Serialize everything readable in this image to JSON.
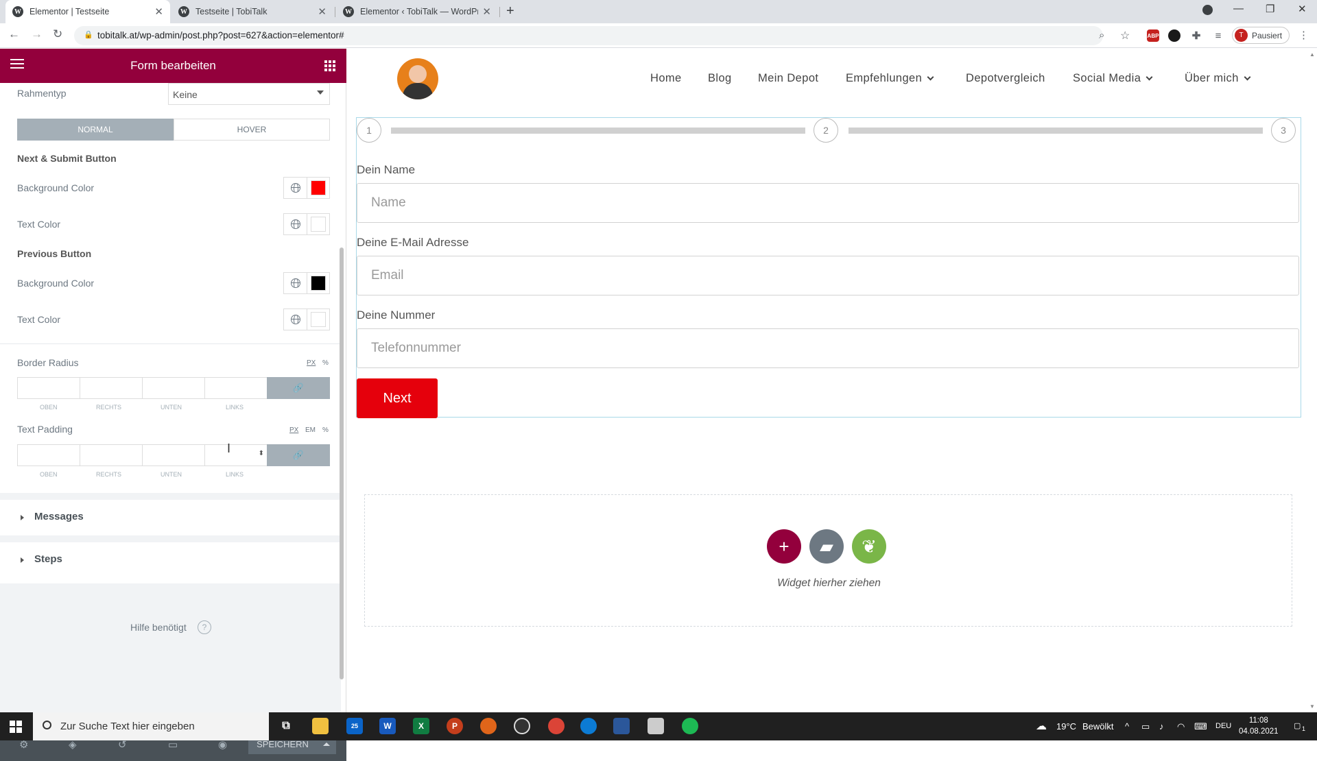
{
  "browser": {
    "tabs": [
      {
        "title": "Elementor | Testseite",
        "icon": "wordpress-icon"
      },
      {
        "title": "Testseite | TobiTalk",
        "icon": "wordpress-icon"
      },
      {
        "title": "Elementor ‹ TobiTalk — WordPress",
        "icon": "wordpress-icon"
      }
    ],
    "url": "tobitalk.at/wp-admin/post.php?post=627&action=elementor#",
    "profile_avatar": "T",
    "profile_status": "Pausiert",
    "ext_abp": "ABP"
  },
  "panel": {
    "title": "Form bearbeiten",
    "border_type_label": "Rahmentyp",
    "border_type_value": "Keine",
    "tab_normal": "NORMAL",
    "tab_hover": "HOVER",
    "next_submit_heading": "Next & Submit Button",
    "background_color_label": "Background Color",
    "text_color_label": "Text Color",
    "previous_heading": "Previous Button",
    "colors": {
      "next_bg": "#ff0000",
      "next_text": "#ffffff",
      "prev_bg": "#000000",
      "prev_text": "#ffffff"
    },
    "border_radius_label": "Border Radius",
    "units_px": "PX",
    "units_percent": "%",
    "units_em": "EM",
    "text_padding_label": "Text Padding",
    "dim_labels": [
      "OBEN",
      "RECHTS",
      "UNTEN",
      "LINKS"
    ],
    "section_messages": "Messages",
    "section_steps": "Steps",
    "help_text": "Hilfe benötigt",
    "help_icon": "?",
    "save_label": "SPEICHERN"
  },
  "site": {
    "nav": [
      "Home",
      "Blog",
      "Mein Depot",
      "Empfehlungen",
      "Depotvergleich",
      "Social Media",
      "Über mich"
    ],
    "steps": [
      "1",
      "2",
      "3"
    ],
    "fields": [
      {
        "label": "Dein Name",
        "placeholder": "Name"
      },
      {
        "label": "Deine E-Mail Adresse",
        "placeholder": "Email"
      },
      {
        "label": "Deine Nummer",
        "placeholder": "Telefonnummer"
      }
    ],
    "next_button": "Next",
    "dropzone_text": "Widget hierher ziehen",
    "accent_color": "#93003c",
    "button_color": "#e5000c"
  },
  "taskbar": {
    "search_placeholder": "Zur Suche Text hier eingeben",
    "mail_badge": "25",
    "weather": "19°C",
    "weather_desc": "Bewölkt",
    "language": "DEU",
    "time": "11:08",
    "date": "04.08.2021",
    "notification_count": "1"
  }
}
